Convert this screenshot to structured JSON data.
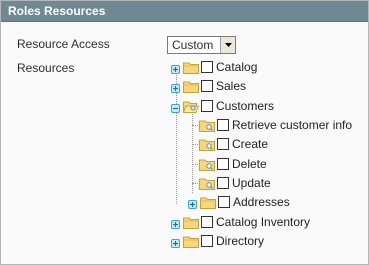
{
  "panel": {
    "title": "Roles Resources"
  },
  "form": {
    "resource_access_label": "Resource Access",
    "resource_access_value": "Custom",
    "resources_label": "Resources"
  },
  "tree": {
    "items": [
      {
        "label": "Catalog",
        "expandable": true,
        "expanded": false,
        "checked": false
      },
      {
        "label": "Sales",
        "expandable": true,
        "expanded": false,
        "checked": false
      },
      {
        "label": "Customers",
        "expandable": true,
        "expanded": true,
        "checked": false,
        "children": [
          {
            "label": "Retrieve customer info",
            "checked": false
          },
          {
            "label": "Create",
            "checked": false
          },
          {
            "label": "Delete",
            "checked": false
          },
          {
            "label": "Update",
            "checked": false
          },
          {
            "label": "Addresses",
            "expandable": true,
            "expanded": false,
            "checked": false
          }
        ]
      },
      {
        "label": "Catalog Inventory",
        "expandable": true,
        "expanded": false,
        "checked": false
      },
      {
        "label": "Directory",
        "expandable": true,
        "expanded": false,
        "checked": false
      }
    ]
  }
}
